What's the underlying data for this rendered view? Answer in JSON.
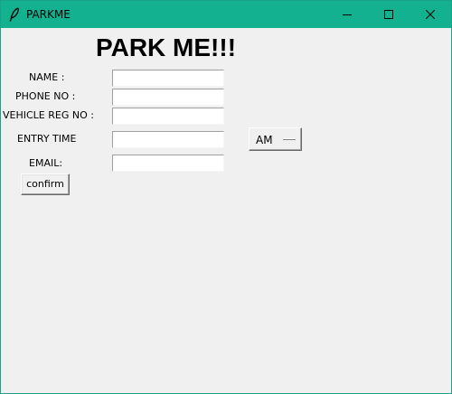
{
  "window": {
    "title": "PARKME",
    "icon": "feather-icon",
    "controls": [
      "minimize-icon",
      "maximize-icon",
      "close-icon"
    ]
  },
  "form": {
    "heading": "PARK ME!!!",
    "fields": [
      {
        "label": "NAME :",
        "value": ""
      },
      {
        "label": "PHONE NO :",
        "value": ""
      },
      {
        "label": "VEHICLE REG NO :",
        "value": ""
      },
      {
        "label": "ENTRY TIME",
        "value": ""
      },
      {
        "label": "EMAIL:",
        "value": ""
      }
    ],
    "time_period": {
      "selected": "AM"
    },
    "confirm_label": "confirm"
  },
  "colors": {
    "titlebar": "#13b18f",
    "window_bg": "#f0f0f0"
  }
}
